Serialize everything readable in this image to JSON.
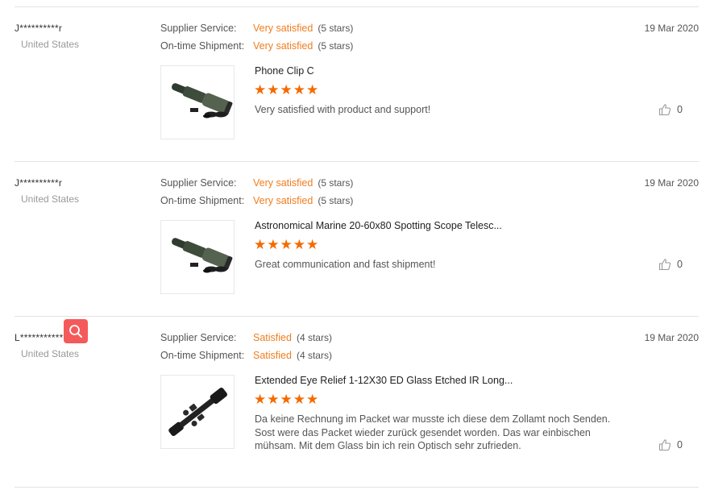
{
  "labels": {
    "supplier_service": "Supplier Service:",
    "ontime_shipment": "On-time Shipment:"
  },
  "reviews": [
    {
      "buyer": "J**********r",
      "country": "United States",
      "date": "19 Mar 2020",
      "supplier_service": {
        "text": "Very satisfied",
        "stars": "(5 stars)"
      },
      "ontime_shipment": {
        "text": "Very satisfied",
        "stars": "(5 stars)"
      },
      "product_title": "Phone Clip C",
      "rating_stars": "★★★★★",
      "review_text": "Very satisfied with product and support!",
      "helpful_count": "0",
      "image_icon": "spotting-scope-image"
    },
    {
      "buyer": "J**********r",
      "country": "United States",
      "date": "19 Mar 2020",
      "supplier_service": {
        "text": "Very satisfied",
        "stars": "(5 stars)"
      },
      "ontime_shipment": {
        "text": "Very satisfied",
        "stars": "(5 stars)"
      },
      "product_title": "Astronomical Marine 20-60x80 Spotting Scope Telesc...",
      "rating_stars": "★★★★★",
      "review_text": "Great communication and fast shipment!",
      "helpful_count": "0",
      "image_icon": "spotting-scope-image"
    },
    {
      "buyer": "L*************d",
      "country": "United States",
      "date": "19 Mar 2020",
      "supplier_service": {
        "text": "Satisfied",
        "stars": "(4 stars)"
      },
      "ontime_shipment": {
        "text": "Satisfied",
        "stars": "(4 stars)"
      },
      "product_title": "Extended Eye Relief 1-12X30 ED Glass Etched IR Long...",
      "rating_stars": "★★★★★",
      "review_text": "Da keine Rechnung im Packet war musste ich diese dem Zollamt noch Senden. Sost were das Packet wieder zurück gesendet worden. Das war einbischen mühsam. Mit dem Glass bin ich rein Optisch sehr zufrieden.",
      "helpful_count": "0",
      "image_icon": "rifle-scope-image"
    }
  ],
  "colors": {
    "accent_orange": "#f07d1f",
    "star_orange": "#f56a00",
    "zoom_button": "#f45a5a"
  },
  "icons": {
    "helpful": "thumbs-up-icon",
    "zoom": "search-icon"
  }
}
